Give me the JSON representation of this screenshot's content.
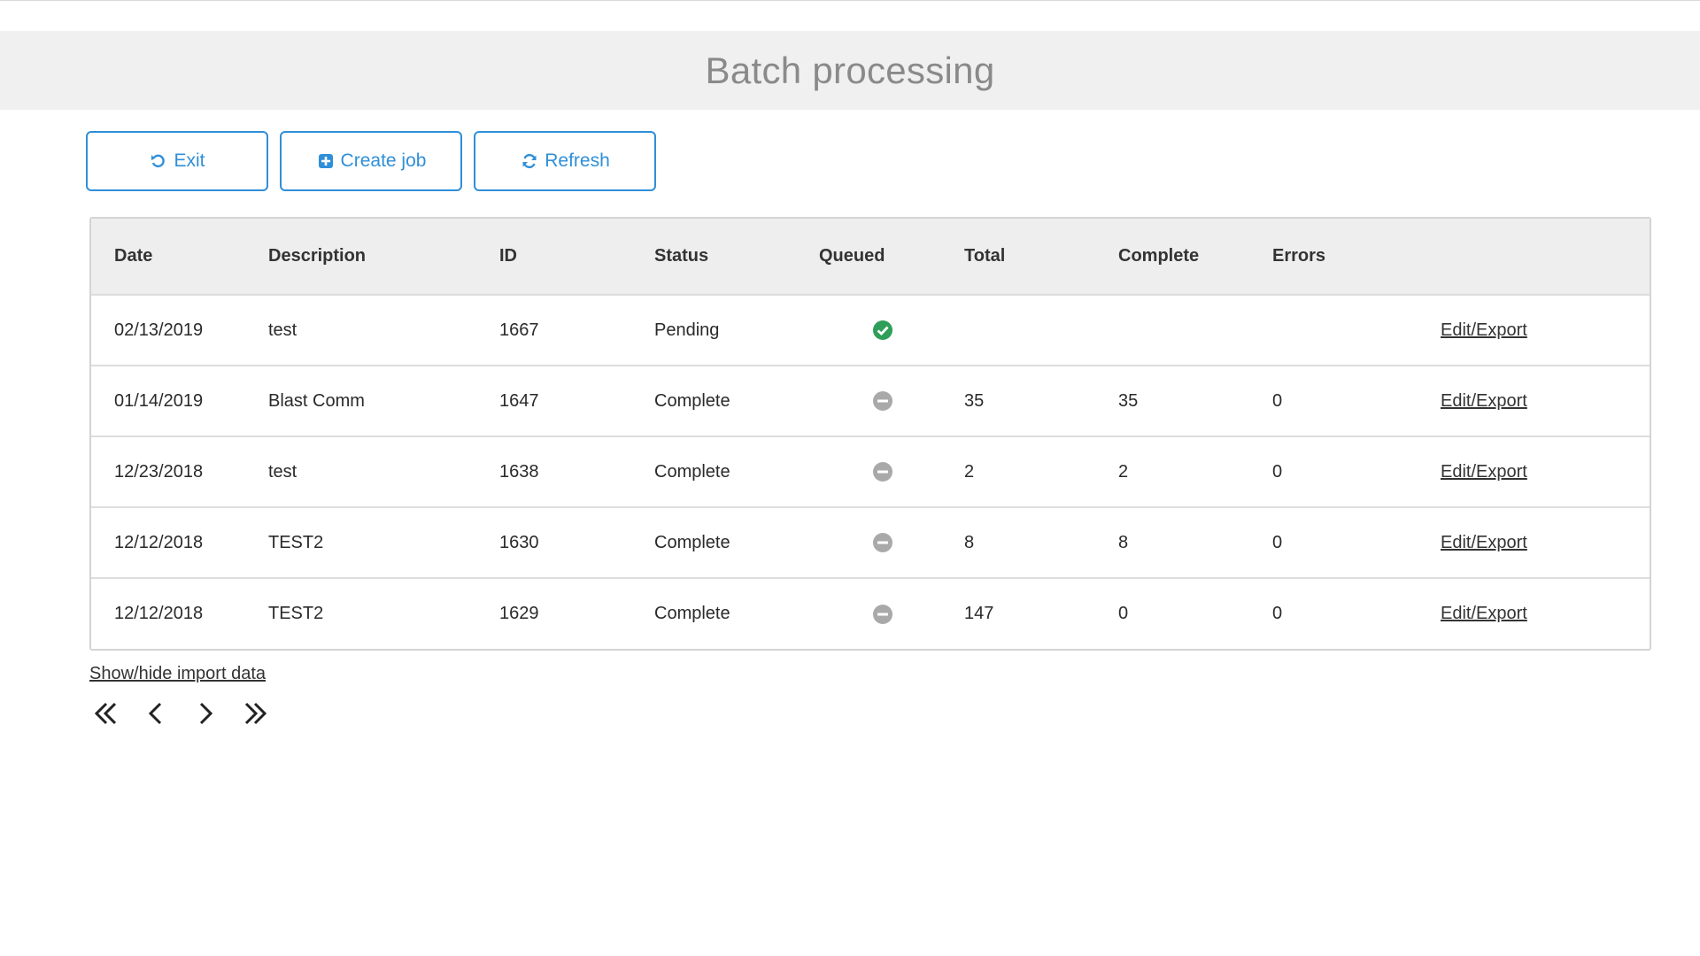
{
  "header": {
    "title": "Batch processing"
  },
  "toolbar": {
    "exit_label": "Exit",
    "create_label": "Create job",
    "refresh_label": "Refresh"
  },
  "colors": {
    "accent": "#2f8fd8",
    "queued_check": "#2e9e58",
    "queued_none": "#a9a9a9",
    "header_bg": "#f0f0f0"
  },
  "table": {
    "columns": [
      "Date",
      "Description",
      "ID",
      "Status",
      "Queued",
      "Total",
      "Complete",
      "Errors",
      ""
    ],
    "rows": [
      {
        "date": "02/13/2019",
        "description": "test",
        "id": "1667",
        "status": "Pending",
        "queued": "check-circle-icon",
        "total": "",
        "complete": "",
        "errors": "",
        "action": "Edit/Export"
      },
      {
        "date": "01/14/2019",
        "description": "Blast Comm",
        "id": "1647",
        "status": "Complete",
        "queued": "minus-circle-icon",
        "total": "35",
        "complete": "35",
        "errors": "0",
        "action": "Edit/Export"
      },
      {
        "date": "12/23/2018",
        "description": "test",
        "id": "1638",
        "status": "Complete",
        "queued": "minus-circle-icon",
        "total": "2",
        "complete": "2",
        "errors": "0",
        "action": "Edit/Export"
      },
      {
        "date": "12/12/2018",
        "description": "TEST2",
        "id": "1630",
        "status": "Complete",
        "queued": "minus-circle-icon",
        "total": "8",
        "complete": "8",
        "errors": "0",
        "action": "Edit/Export"
      },
      {
        "date": "12/12/2018",
        "description": "TEST2",
        "id": "1629",
        "status": "Complete",
        "queued": "minus-circle-icon",
        "total": "147",
        "complete": "0",
        "errors": "0",
        "action": "Edit/Export"
      }
    ]
  },
  "footer": {
    "show_hide_label": "Show/hide import data"
  },
  "pager": {
    "icons": [
      "first-page-icon",
      "prev-page-icon",
      "next-page-icon",
      "last-page-icon"
    ]
  }
}
